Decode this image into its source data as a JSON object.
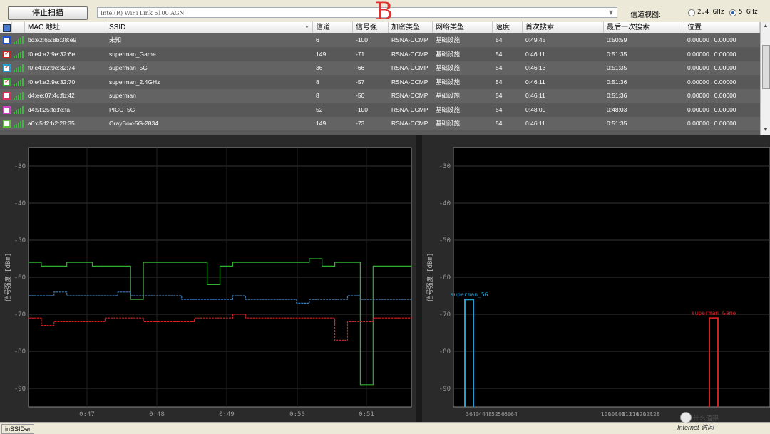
{
  "toolbar": {
    "stop_scan_label": "停止扫描",
    "adapter_value": "Intel(R) WiFi Link 5100 AGN",
    "overlay_letter": "B",
    "channel_view_label": "信道视图:",
    "band_24_label": "2.4 GHz",
    "band_5_label": "5 GHz",
    "selected_band": "5 GHz"
  },
  "table": {
    "columns": [
      "MAC 地址",
      "SSID",
      "信道",
      "信号强",
      "加密类型",
      "网络类型",
      "速度",
      "首次搜索",
      "最后一次搜索",
      "位置"
    ],
    "rows": [
      {
        "mac": "bc:e2:65:8b:38:e9",
        "ssid": "未知",
        "channel": "6",
        "signal": "-100",
        "security": "RSNA-CCMP",
        "net_type": "基础设施",
        "speed": "54",
        "first_seen": "0:49:45",
        "last_seen": "0:50:59",
        "location": "0.00000 , 0.00000",
        "checked": false,
        "color": "#2050d0"
      },
      {
        "mac": "f0:e4:a2:9e:32:6e",
        "ssid": "superman_Game",
        "channel": "149",
        "signal": "-71",
        "security": "RSNA-CCMP",
        "net_type": "基础设施",
        "speed": "54",
        "first_seen": "0:46:11",
        "last_seen": "0:51:35",
        "location": "0.00000 , 0.00000",
        "checked": true,
        "color": "#d02020"
      },
      {
        "mac": "f0:e4:a2:9e:32:74",
        "ssid": "superman_5G",
        "channel": "36",
        "signal": "-66",
        "security": "RSNA-CCMP",
        "net_type": "基础设施",
        "speed": "54",
        "first_seen": "0:46:13",
        "last_seen": "0:51:35",
        "location": "0.00000 , 0.00000",
        "checked": true,
        "color": "#20a0d0"
      },
      {
        "mac": "f0:e4:a2:9e:32:70",
        "ssid": "superman_2.4GHz",
        "channel": "8",
        "signal": "-57",
        "security": "RSNA-CCMP",
        "net_type": "基础设施",
        "speed": "54",
        "first_seen": "0:46:11",
        "last_seen": "0:51:36",
        "location": "0.00000 , 0.00000",
        "checked": true,
        "color": "#30b030"
      },
      {
        "mac": "d4:ee:07:4c:fb:42",
        "ssid": "superman",
        "channel": "8",
        "signal": "-50",
        "security": "RSNA-CCMP",
        "net_type": "基础设施",
        "speed": "54",
        "first_seen": "0:46:11",
        "last_seen": "0:51:36",
        "location": "0.00000 , 0.00000",
        "checked": false,
        "color": "#e03060"
      },
      {
        "mac": "d4:5f:25:fd:fe:fa",
        "ssid": "PICC_5G",
        "channel": "52",
        "signal": "-100",
        "security": "RSNA-CCMP",
        "net_type": "基础设施",
        "speed": "54",
        "first_seen": "0:48:00",
        "last_seen": "0:48:03",
        "location": "0.00000 , 0.00000",
        "checked": false,
        "color": "#d040c0"
      },
      {
        "mac": "a0:c5:f2:b2:28:35",
        "ssid": "OrayBox-5G-2834",
        "channel": "149",
        "signal": "-73",
        "security": "RSNA-CCMP",
        "net_type": "基础设施",
        "speed": "54",
        "first_seen": "0:46:11",
        "last_seen": "0:51:35",
        "location": "0.00000 , 0.00000",
        "checked": false,
        "color": "#60c040"
      }
    ]
  },
  "chart_data": [
    {
      "type": "line",
      "ylabel": "信号强度 [dBm]",
      "ylim": [
        -95,
        -25
      ],
      "yticks": [
        -30,
        -40,
        -50,
        -60,
        -70,
        -80,
        -90
      ],
      "x_ticks": [
        "0:47",
        "0:48",
        "0:49",
        "0:50",
        "0:51"
      ],
      "series": [
        {
          "color": "#30b030",
          "values": [
            -56,
            -57,
            -57,
            -56,
            -56,
            -57,
            -57,
            -57,
            -66,
            -56,
            -56,
            -56,
            -56,
            -56,
            -62,
            -57,
            -56,
            -56,
            -56,
            -56,
            -56,
            -56,
            -55,
            -57,
            -56,
            -56,
            -89,
            -57,
            -57,
            -57,
            -57
          ]
        },
        {
          "color": "#3a7fc0",
          "values": [
            -65,
            -65,
            -64,
            -65,
            -65,
            -65,
            -65,
            -64,
            -65,
            -65,
            -65,
            -65,
            -66,
            -66,
            -66,
            -66,
            -65,
            -66,
            -66,
            -66,
            -66,
            -67,
            -66,
            -66,
            -66,
            -65,
            -66,
            -66,
            -66,
            -66,
            -66
          ]
        },
        {
          "color": "#d02020",
          "values": [
            -71,
            -73,
            -72,
            -72,
            -72,
            -72,
            -71,
            -71,
            -71,
            -72,
            -72,
            -72,
            -72,
            -71,
            -71,
            -71,
            -70,
            -71,
            -71,
            -71,
            -71,
            -71,
            -71,
            -71,
            -77,
            -72,
            -72,
            -71,
            -71,
            -71,
            -71
          ]
        }
      ]
    },
    {
      "type": "area",
      "ylabel": "信号强度 [dBm]",
      "ylim": [
        -95,
        -25
      ],
      "yticks": [
        -30,
        -40,
        -50,
        -60,
        -70,
        -80,
        -90
      ],
      "x_ticks": [
        "36",
        "40",
        "44",
        "48",
        "52",
        "56",
        "60",
        "64",
        "100",
        "104",
        "108",
        "112",
        "116",
        "120",
        "124",
        "128"
      ],
      "series": [
        {
          "name": "superman_5G",
          "channel": 36,
          "value": -66,
          "color": "#20a0d0"
        },
        {
          "name": "superman_Game",
          "channel": 149,
          "value": -71,
          "color": "#d02020"
        }
      ]
    }
  ],
  "status": {
    "app_label": "inSSIDer"
  },
  "watermark": {
    "text": "什么值得",
    "sub": "Internet 访问"
  }
}
